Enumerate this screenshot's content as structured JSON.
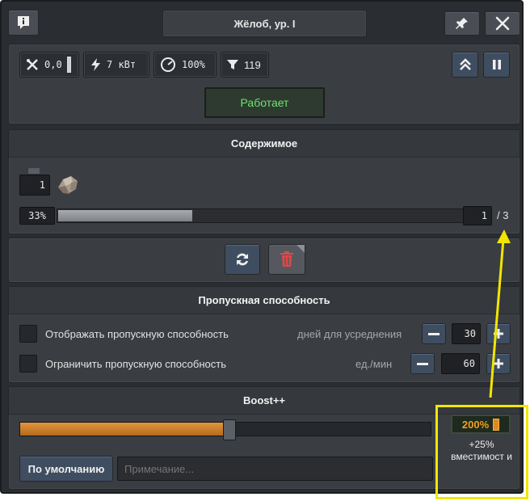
{
  "window": {
    "title": "Жёлоб, ур. I"
  },
  "stats": {
    "heat": "0,0",
    "power": "7 кВт",
    "speed": "100%",
    "filter": "119"
  },
  "status": {
    "text": "Работает",
    "color": "#6ee26e"
  },
  "contents": {
    "header": "Содержимое",
    "stack_count": "1",
    "fill_percent": "33%",
    "fill_fraction": 0.33,
    "slot_value": "1",
    "slot_max": "/ 3"
  },
  "throughput": {
    "header": "Пропускная способность",
    "row1_label": "Отображать пропускную способность",
    "row1_unit": "дней для усреднения",
    "row1_value": "30",
    "row2_label": "Ограничить пропускную способность",
    "row2_unit": "ед./мин",
    "row2_value": "60"
  },
  "boost": {
    "header": "Boost++",
    "slider_fraction": 0.51,
    "value": "200%",
    "bonus_text": "+25% вместимост и",
    "default_button": "По умолчанию",
    "note_placeholder": "Примечание..."
  },
  "colors": {
    "accent_orange": "#d88a2f",
    "highlight_yellow": "#f2e600",
    "panel": "#3a3d42"
  },
  "icons": {
    "info": "info-icon",
    "pin": "pin-icon",
    "close": "close-icon",
    "heat": "crossed-tools-icon",
    "power": "lightning-icon",
    "speed": "gauge-icon",
    "filter": "filter-icon",
    "collapse": "double-chevron-up-icon",
    "pause": "pause-icon",
    "refresh": "refresh-icon",
    "delete": "trash-icon"
  }
}
